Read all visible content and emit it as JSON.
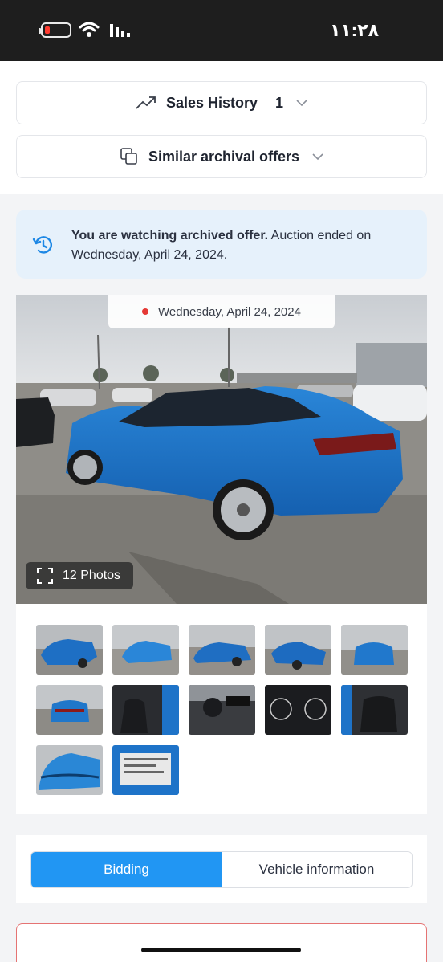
{
  "status_bar": {
    "time": "١١:٢٨"
  },
  "sales_history": {
    "label": "Sales History",
    "count": "1"
  },
  "similar_offers": {
    "label": "Similar archival offers"
  },
  "archived_banner": {
    "bold_text": "You are watching archived offer.",
    "text": " Auction ended on Wednesday, April 24, 2024."
  },
  "gallery": {
    "date": "Wednesday, April 24, 2024",
    "photos_label": "12 Photos",
    "thumbnails": [
      "front-damage-left",
      "rear-left",
      "side-left",
      "front-right",
      "front-view",
      "rear-view",
      "front-seats",
      "dashboard",
      "instrument-cluster",
      "rear-seats",
      "hood-damage",
      "window-sticker"
    ]
  },
  "tabs": {
    "bidding": "Bidding",
    "vehicle_info": "Vehicle information"
  },
  "colors": {
    "accent": "#2196f3",
    "banner_bg": "#e6f1fb",
    "car_blue": "#1e73c8"
  }
}
